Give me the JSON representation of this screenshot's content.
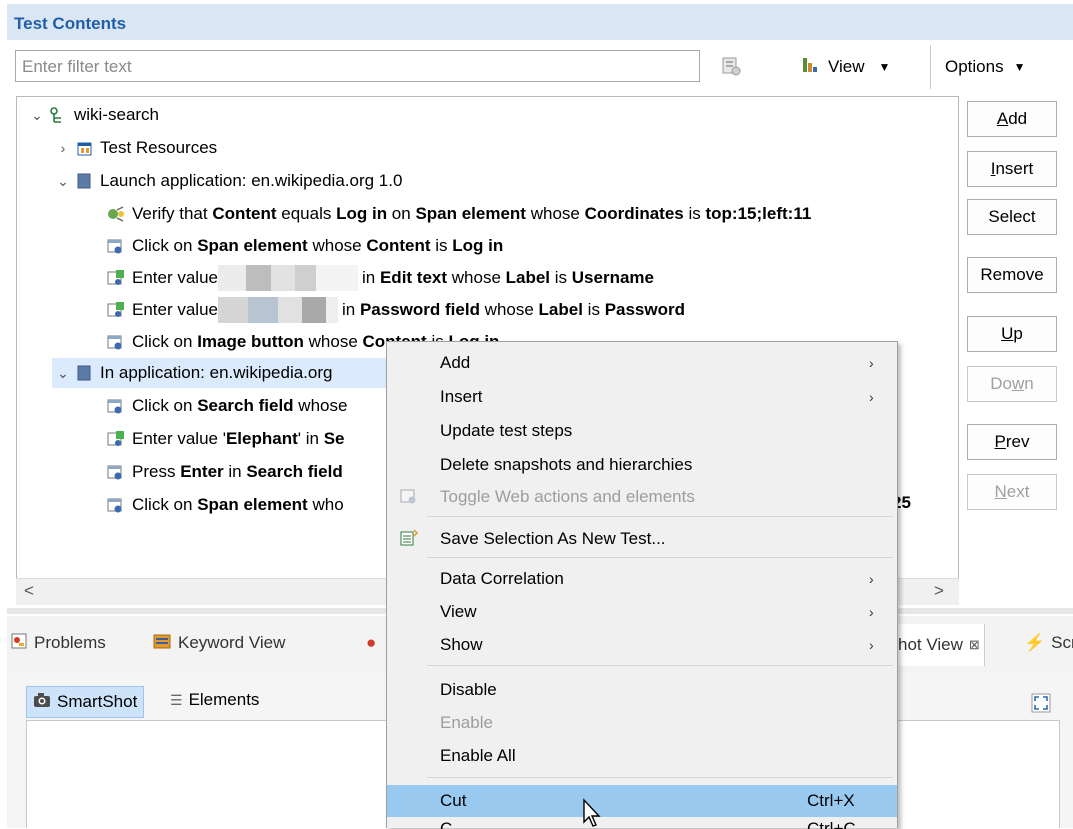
{
  "panel": {
    "title": "Test Contents"
  },
  "toolbar": {
    "filter_placeholder": "Enter filter text",
    "view_label": "View",
    "options_label": "Options"
  },
  "tree": {
    "root": "wiki-search",
    "resources": "Test Resources",
    "launch": "Launch application: en.wikipedia.org  1.0",
    "launch_steps": [
      {
        "parts": [
          [
            "Verify that ",
            false
          ],
          [
            "Content",
            true
          ],
          [
            " equals ",
            false
          ],
          [
            "Log in",
            true
          ],
          [
            " on ",
            false
          ],
          [
            "Span element",
            true
          ],
          [
            " whose ",
            false
          ],
          [
            "Coordinates",
            true
          ],
          [
            " is ",
            false
          ],
          [
            "top:15;left:11",
            true
          ]
        ]
      },
      {
        "parts": [
          [
            "Click on ",
            false
          ],
          [
            "Span element",
            true
          ],
          [
            " whose ",
            false
          ],
          [
            "Content",
            true
          ],
          [
            " is ",
            false
          ],
          [
            "Log in",
            true
          ]
        ]
      },
      {
        "pre": "Enter value ",
        "parts": [
          [
            "in ",
            false
          ],
          [
            "Edit text",
            true
          ],
          [
            " whose ",
            false
          ],
          [
            "Label",
            true
          ],
          [
            " is ",
            false
          ],
          [
            "Username",
            true
          ]
        ]
      },
      {
        "pre": "Enter value ",
        "parts": [
          [
            "in ",
            false
          ],
          [
            "Password field",
            true
          ],
          [
            " whose ",
            false
          ],
          [
            "Label",
            true
          ],
          [
            " is ",
            false
          ],
          [
            "Password",
            true
          ]
        ]
      },
      {
        "parts": [
          [
            "Click on ",
            false
          ],
          [
            "Image button",
            true
          ],
          [
            " whose ",
            false
          ],
          [
            "Content",
            true
          ],
          [
            " is ",
            false
          ],
          [
            "Log in",
            true
          ]
        ]
      }
    ],
    "in_app": "In application: en.wikipedia.org",
    "in_app_steps": [
      {
        "parts": [
          [
            "Click on ",
            false
          ],
          [
            "Search field",
            true
          ],
          [
            " whose",
            false
          ]
        ]
      },
      {
        "parts": [
          [
            "Enter value '",
            false
          ],
          [
            "Elephant",
            true
          ],
          [
            "' in ",
            false
          ],
          [
            "Se",
            true
          ]
        ]
      },
      {
        "parts": [
          [
            "Press ",
            false
          ],
          [
            "Enter",
            true
          ],
          [
            " in ",
            false
          ],
          [
            "Search field",
            true
          ]
        ]
      },
      {
        "parts": [
          [
            "Click on ",
            false
          ],
          [
            "Span element",
            true
          ],
          [
            " who",
            false
          ]
        ]
      }
    ],
    "trailing_fragment": "25"
  },
  "side_buttons": [
    {
      "label": "Add",
      "u": 0,
      "enabled": true
    },
    {
      "label": "Insert",
      "u": 0,
      "enabled": true
    },
    {
      "label": "Select",
      "u": -1,
      "enabled": true
    },
    {
      "label": "Remove",
      "u": -1,
      "enabled": true
    },
    {
      "label": "Up",
      "u": 0,
      "enabled": true
    },
    {
      "label": "Down",
      "u": 2,
      "enabled": false
    },
    {
      "label": "Prev",
      "u": 0,
      "enabled": true
    },
    {
      "label": "Next",
      "u": 0,
      "enabled": false
    }
  ],
  "bottom_tabs": {
    "problems": "Problems",
    "keyword_view": "Keyword View",
    "snapshot_view": "hot View",
    "scr": "Scr"
  },
  "lower_tabs": {
    "smartshot": "SmartShot",
    "elements": "Elements"
  },
  "context_menu": [
    {
      "label": "Add",
      "submenu": true
    },
    {
      "label": "Insert",
      "submenu": true
    },
    {
      "label": "Update test steps"
    },
    {
      "label": "Delete snapshots and hierarchies"
    },
    {
      "label": "Toggle Web actions and elements",
      "disabled": true,
      "icon": "web-step-icon"
    },
    {
      "sep": true
    },
    {
      "label": "Save Selection As New Test...",
      "icon": "save-test-icon"
    },
    {
      "sep": true
    },
    {
      "label": "Data Correlation",
      "submenu": true
    },
    {
      "label": "View",
      "submenu": true
    },
    {
      "label": "Show",
      "submenu": true
    },
    {
      "sep": true
    },
    {
      "label": "Disable"
    },
    {
      "label": "Enable",
      "disabled": true
    },
    {
      "label": "Enable All"
    },
    {
      "sep": true
    },
    {
      "label": "Cut",
      "shortcut": "Ctrl+X",
      "highlighted": true
    },
    {
      "label": "C",
      "shortcut": "Ctrl+C",
      "clipped": true
    }
  ],
  "colors": {
    "accent_title": "#1f5fa8",
    "selection": "#dbeafc",
    "menu_highlight": "#99c9ef"
  }
}
